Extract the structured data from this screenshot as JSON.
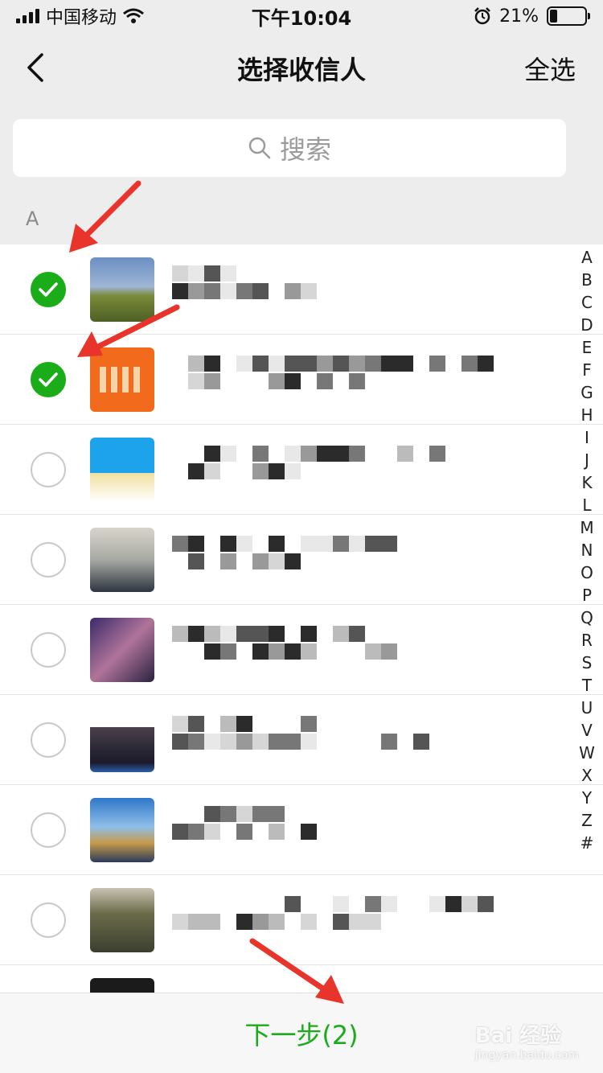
{
  "status_bar": {
    "carrier": "中国移动",
    "time": "下午10:04",
    "battery": "21%",
    "battery_level": 0.21
  },
  "nav": {
    "title": "选择收信人",
    "select_all": "全选"
  },
  "search": {
    "placeholder": "搜索"
  },
  "section_letter": "A",
  "contacts": [
    {
      "selected": true
    },
    {
      "selected": true
    },
    {
      "selected": false
    },
    {
      "selected": false
    },
    {
      "selected": false
    },
    {
      "selected": false
    },
    {
      "selected": false
    },
    {
      "selected": false
    }
  ],
  "index_letters": [
    "A",
    "B",
    "C",
    "D",
    "E",
    "F",
    "G",
    "H",
    "I",
    "J",
    "K",
    "L",
    "M",
    "N",
    "O",
    "P",
    "Q",
    "R",
    "S",
    "T",
    "U",
    "V",
    "W",
    "X",
    "Y",
    "Z",
    "#"
  ],
  "bottom": {
    "next_label": "下一步(2)"
  },
  "watermark": {
    "brand": "Bai 经验",
    "url": "jingyan.baidu.com"
  },
  "colors": {
    "accent_green": "#1aad19",
    "annotation_red": "#e8342a"
  },
  "icons": {
    "back": "chevron-left-icon",
    "search": "search-icon",
    "check": "checkmark-icon",
    "wifi": "wifi-icon",
    "alarm": "alarm-icon"
  }
}
